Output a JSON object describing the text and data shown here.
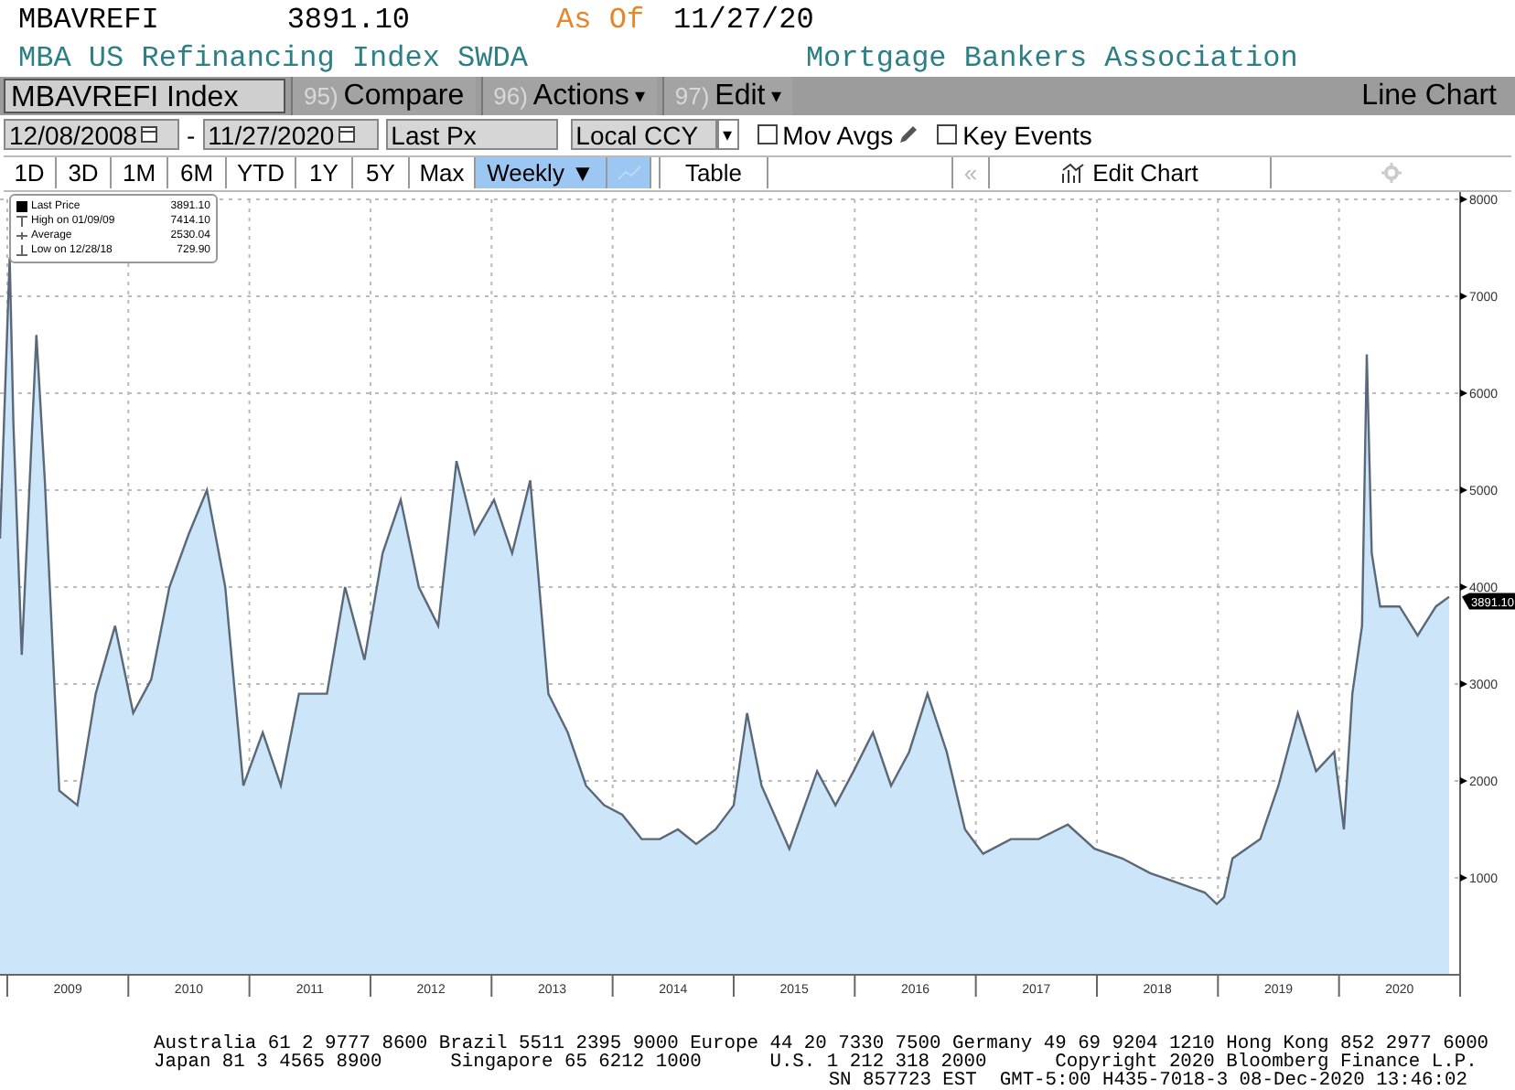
{
  "header": {
    "ticker": "MBAVREFI",
    "price": "3891.10",
    "as_of_label": "As Of",
    "date": "11/27/20",
    "name": "MBA US Refinancing Index SWDA",
    "source": "Mortgage Bankers Association"
  },
  "menu_bar": {
    "security": "MBAVREFI Index",
    "items": [
      {
        "number": "95)",
        "label": "Compare"
      },
      {
        "number": "96)",
        "label": "Actions",
        "caret": "▾"
      },
      {
        "number": "97)",
        "label": "Edit",
        "caret": "▾"
      }
    ],
    "view": "Line Chart"
  },
  "controls": {
    "start_date": "12/08/2008",
    "separator": "-",
    "end_date": "11/27/2020",
    "field": "Last Px",
    "currency": "Local CCY",
    "currency_caret": "▾",
    "options": [
      {
        "label": "Mov Avgs",
        "checked": false,
        "kind": "editable"
      },
      {
        "label": "Key Events",
        "checked": false,
        "kind": "plain"
      }
    ]
  },
  "toolbar": {
    "periods": [
      {
        "label": "1D",
        "selected": false
      },
      {
        "label": "3D",
        "selected": false
      },
      {
        "label": "1M",
        "selected": false
      },
      {
        "label": "6M",
        "selected": false
      },
      {
        "label": "YTD",
        "selected": false
      },
      {
        "label": "1Y",
        "selected": false
      },
      {
        "label": "5Y",
        "selected": false
      },
      {
        "label": "Max",
        "selected": false
      }
    ],
    "frequency": "Weekly ▼",
    "table": "Table",
    "back": "«",
    "edit_chart": "Edit Chart"
  },
  "legend": [
    {
      "kind": "last",
      "value": "3891.10"
    },
    {
      "kind": "high",
      "label": "High on 01/09/09",
      "value": "7414.10"
    },
    {
      "kind": "average",
      "label": "Average",
      "value": "2530.04"
    },
    {
      "kind": "low",
      "label": "Low on 12/28/18",
      "value": "729.90"
    }
  ],
  "chart": {
    "last_tag": "3891.10",
    "chart_data": {
      "type": "area",
      "grid": true,
      "xlim": [
        2008.94,
        2021.0
      ],
      "ylim": [
        0,
        8000
      ],
      "yticks": [
        1000,
        2000,
        3000,
        4000,
        5000,
        6000,
        7000,
        8000
      ],
      "xticks": [
        {
          "value": 2009.5,
          "label": "2009"
        },
        {
          "value": 2010.5,
          "label": "2010"
        },
        {
          "value": 2011.5,
          "label": "2011"
        },
        {
          "value": 2012.5,
          "label": "2012"
        },
        {
          "value": 2013.5,
          "label": "2013"
        },
        {
          "value": 2014.5,
          "label": "2014"
        },
        {
          "value": 2015.5,
          "label": "2015"
        },
        {
          "value": 2016.5,
          "label": "2016"
        },
        {
          "value": 2017.5,
          "label": "2017"
        },
        {
          "value": 2018.5,
          "label": "2018"
        },
        {
          "value": 2019.5,
          "label": "2019"
        },
        {
          "value": 2020.5,
          "label": "2020"
        }
      ],
      "x": [
        2008.94,
        2009.02,
        2009.05,
        2009.12,
        2009.24,
        2009.31,
        2009.43,
        2009.58,
        2009.73,
        2009.89,
        2010.04,
        2010.19,
        2010.34,
        2010.5,
        2010.65,
        2010.8,
        2010.95,
        2011.11,
        2011.26,
        2011.41,
        2011.64,
        2011.79,
        2011.95,
        2012.1,
        2012.25,
        2012.4,
        2012.56,
        2012.71,
        2012.86,
        2013.02,
        2013.17,
        2013.32,
        2013.47,
        2013.63,
        2013.78,
        2013.93,
        2014.08,
        2014.24,
        2014.39,
        2014.54,
        2014.69,
        2014.85,
        2015.0,
        2015.11,
        2015.23,
        2015.46,
        2015.69,
        2015.84,
        2015.99,
        2016.15,
        2016.3,
        2016.45,
        2016.6,
        2016.76,
        2016.91,
        2017.06,
        2017.29,
        2017.52,
        2017.76,
        2017.98,
        2018.21,
        2018.44,
        2018.66,
        2018.89,
        2018.99,
        2019.05,
        2019.12,
        2019.35,
        2019.5,
        2019.66,
        2019.81,
        2019.96,
        2020.04,
        2020.11,
        2020.19,
        2020.23,
        2020.27,
        2020.34,
        2020.5,
        2020.65,
        2020.8,
        2020.91
      ],
      "series": [
        {
          "name": "Last Price",
          "color": "#5a6878",
          "values": [
            4500,
            7400,
            5700,
            3300,
            6600,
            5100,
            1900,
            1750,
            2900,
            3600,
            2700,
            3050,
            4000,
            4550,
            5000,
            4000,
            1950,
            2500,
            1950,
            2900,
            2900,
            4000,
            3250,
            4350,
            4900,
            4000,
            3600,
            5300,
            4550,
            4900,
            4350,
            5100,
            2900,
            2500,
            1950,
            1750,
            1650,
            1400,
            1400,
            1500,
            1350,
            1500,
            1750,
            2700,
            1950,
            1300,
            2100,
            1750,
            2100,
            2500,
            1950,
            2300,
            2900,
            2300,
            1500,
            1250,
            1400,
            1400,
            1550,
            1300,
            1200,
            1050,
            950,
            850,
            730,
            800,
            1200,
            1400,
            1950,
            2700,
            2100,
            2300,
            1500,
            2900,
            3600,
            6400,
            4350,
            3800,
            3800,
            3500,
            3800,
            3900
          ]
        }
      ]
    }
  },
  "footer": [
    "Australia 61 2 9777 8600 Brazil 5511 2395 9000 Europe 44 20 7330 7500 Germany 49 69 9204 1210 Hong Kong 852 2977 6000",
    "Japan 81 3 4565 8900      Singapore 65 6212 1000      U.S. 1 212 318 2000      Copyright 2020 Bloomberg Finance L.P.",
    "SN 857723 EST  GMT-5:00 H435-7018-3 08-Dec-2020 13:46:02"
  ]
}
